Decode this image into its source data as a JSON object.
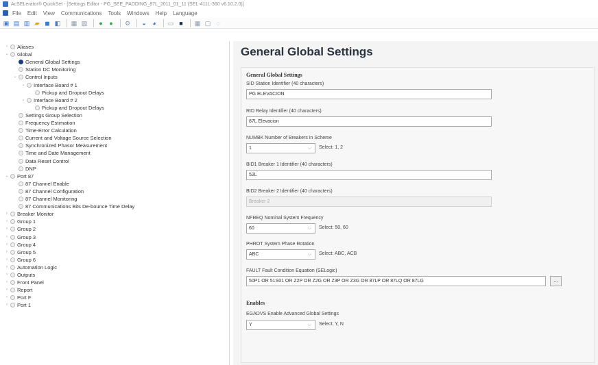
{
  "window": {
    "title": "AcSELerator® QuickSet - [Settings Editor - PG_SEE_PADDING_87L_2011_01_11 (SEL-411L-360 v6.10.2.0)]"
  },
  "menu": [
    "File",
    "Edit",
    "View",
    "Communications",
    "Tools",
    "Windows",
    "Help",
    "Language"
  ],
  "toolbar": {
    "icons": [
      "new-icon",
      "open-icon",
      "save-icon",
      "folder-icon",
      "disk-icon",
      "read-icon",
      "send-icon",
      "compare-icon",
      "connect-green-icon",
      "disconnect-green-icon",
      "settings-icon",
      "print-icon",
      "help-icon",
      "terminal-icon",
      "monitor-icon",
      "grid-icon",
      "hmi-icon",
      "info-icon"
    ]
  },
  "tree": [
    {
      "label": "Aliases",
      "level": 0,
      "exp": ">"
    },
    {
      "label": "Global",
      "level": 0,
      "exp": "v"
    },
    {
      "label": "General Global Settings",
      "level": 1,
      "selected": true
    },
    {
      "label": "Station DC Monitoring",
      "level": 1
    },
    {
      "label": "Control Inputs",
      "level": 1,
      "exp": "v"
    },
    {
      "label": "Interface Board # 1",
      "level": 2,
      "exp": "v"
    },
    {
      "label": "Pickup and Dropout Delays",
      "level": 3
    },
    {
      "label": "Interface Board # 2",
      "level": 2,
      "exp": "v"
    },
    {
      "label": "Pickup and Dropout Delays",
      "level": 3
    },
    {
      "label": "Settings Group Selection",
      "level": 1
    },
    {
      "label": "Frequency Estimation",
      "level": 1
    },
    {
      "label": "Time-Error Calculation",
      "level": 1
    },
    {
      "label": "Current and Voltage Source Selection",
      "level": 1
    },
    {
      "label": "Synchronized Phasor Measurement",
      "level": 1
    },
    {
      "label": "Time and Date Management",
      "level": 1
    },
    {
      "label": "Data Reset Control",
      "level": 1
    },
    {
      "label": "DNP",
      "level": 1
    },
    {
      "label": "Port 87",
      "level": 0,
      "exp": "v"
    },
    {
      "label": "87 Channel Enable",
      "level": 1
    },
    {
      "label": "87 Channel Configuration",
      "level": 1
    },
    {
      "label": "87 Channel Monitoring",
      "level": 1
    },
    {
      "label": "87 Communications Bits De-bounce Time Delay",
      "level": 1
    },
    {
      "label": "Breaker Monitor",
      "level": 0,
      "exp": ">"
    },
    {
      "label": "Group 1",
      "level": 0,
      "exp": ">"
    },
    {
      "label": "Group 2",
      "level": 0,
      "exp": ">"
    },
    {
      "label": "Group 3",
      "level": 0,
      "exp": ">"
    },
    {
      "label": "Group 4",
      "level": 0,
      "exp": ">"
    },
    {
      "label": "Group 5",
      "level": 0,
      "exp": ">"
    },
    {
      "label": "Group 6",
      "level": 0,
      "exp": ">"
    },
    {
      "label": "Automation Logic",
      "level": 0,
      "exp": ">"
    },
    {
      "label": "Outputs",
      "level": 0,
      "exp": ">"
    },
    {
      "label": "Front Panel",
      "level": 0,
      "exp": ">"
    },
    {
      "label": "Report",
      "level": 0,
      "exp": ">"
    },
    {
      "label": "Port F",
      "level": 0,
      "exp": ">"
    },
    {
      "label": "Port 1",
      "level": 0,
      "exp": ">"
    }
  ],
  "content": {
    "page_title": "General Global Settings",
    "section_general": "General Global Settings",
    "sid_label": "SID  Station Identifier (40 characters)",
    "sid_value": "PG ELEVACION",
    "rid_label": "RID  Relay Identifier (40 characters)",
    "rid_value": "87L Elevacion",
    "numbk_label": "NUMBK  Number of Breakers in Scheme",
    "numbk_value": "1",
    "numbk_hint": "Select: 1, 2",
    "bid1_label": "BID1  Breaker 1 Identifier (40 characters)",
    "bid1_value": "52L",
    "bid2_label": "BID2  Breaker 2 Identifier (40 characters)",
    "bid2_value": "Breaker 2",
    "nfreq_label": "NFREQ  Nominal System Frequency",
    "nfreq_value": "60",
    "nfreq_hint": "Select: 50, 60",
    "phrot_label": "PHROT  System Phase Rotation",
    "phrot_value": "ABC",
    "phrot_hint": "Select: ABC, ACB",
    "fault_label": "FAULT  Fault Condition Equation (SELogic)",
    "fault_value": "50P1 OR 51S01 OR Z2P OR Z2G OR Z3P OR Z3G OR 87LP OR 87LQ OR 87LG",
    "fault_button": "...",
    "section_enables": "Enables",
    "egadvs_label": "EGADVS  Enable Advanced Global Settings",
    "egadvs_value": "Y",
    "egadvs_hint": "Select: Y, N"
  }
}
